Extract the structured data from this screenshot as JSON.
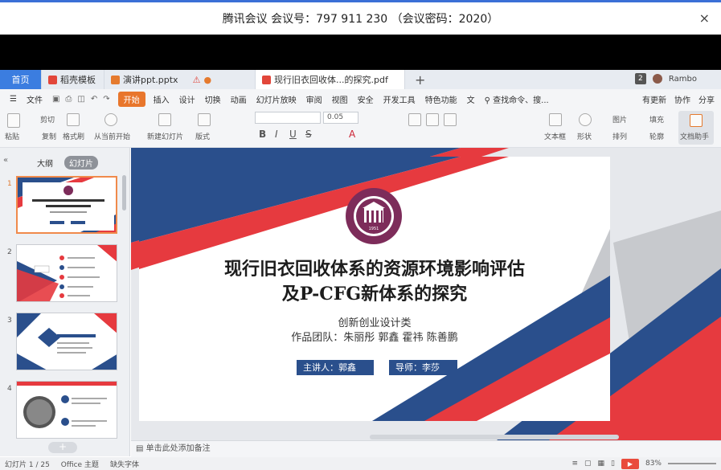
{
  "meeting": {
    "title": "腾讯会议 会议号：797 911 230 （会议密码：2020）",
    "close": "×"
  },
  "tabs": {
    "home": "首页",
    "items": [
      {
        "label": "稻壳模板",
        "color": "#e2463a"
      },
      {
        "label": "演讲ppt.pptx",
        "color": "#e57a2e"
      },
      {
        "label": "现行旧衣回收体...的探究.pdf",
        "color": "#e2463a"
      }
    ],
    "warn": "⚠",
    "dot": "●",
    "plus": "+",
    "badge": "2",
    "user": "Rambo"
  },
  "menu": {
    "file": "文件",
    "start": "开始",
    "items": [
      "插入",
      "设计",
      "切换",
      "动画",
      "幻灯片放映",
      "审阅",
      "视图",
      "安全",
      "开发工具",
      "特色功能",
      "文"
    ],
    "search": "查找命令、搜...",
    "right": [
      "有更新",
      "协作",
      "分享"
    ]
  },
  "ribbon": {
    "paste": "粘贴",
    "cut": "剪切",
    "copy": "复制",
    "format_painter": "格式刷",
    "from_current": "从当前开始",
    "new_slide": "新建幻灯片",
    "layout": "版式",
    "font_size": "0.05",
    "textbox": "文本框",
    "shape": "形状",
    "arrange": "排列",
    "picture": "图片",
    "fill": "填充",
    "outline": "轮廓",
    "doc_assistant": "文档助手"
  },
  "left_panel": {
    "tab_outline": "大纲",
    "tab_slides": "幻灯片",
    "thumb_numbers": [
      "1",
      "2",
      "3",
      "4"
    ],
    "add": "+"
  },
  "slide": {
    "title_line1": "现行旧衣回收体系的资源环境影响评估",
    "title_line2": "及P-CFG新体系的探究",
    "category": "创新创业设计类",
    "team": "作品团队：朱丽彤 郭鑫 霍祎 陈善鹏",
    "presenter": "主讲人：郭鑫",
    "advisor": "导师：李莎",
    "logo_year": "1951"
  },
  "notes": {
    "placeholder": "单击此处添加备注"
  },
  "status": {
    "slide_count": "幻灯片 1 / 25",
    "theme": "Office 主题",
    "font_missing": "缺失字体",
    "zoom": "83%"
  },
  "colors": {
    "red": "#e63a3f",
    "navy": "#2a4f8c",
    "accent_orange": "#e8762c"
  }
}
